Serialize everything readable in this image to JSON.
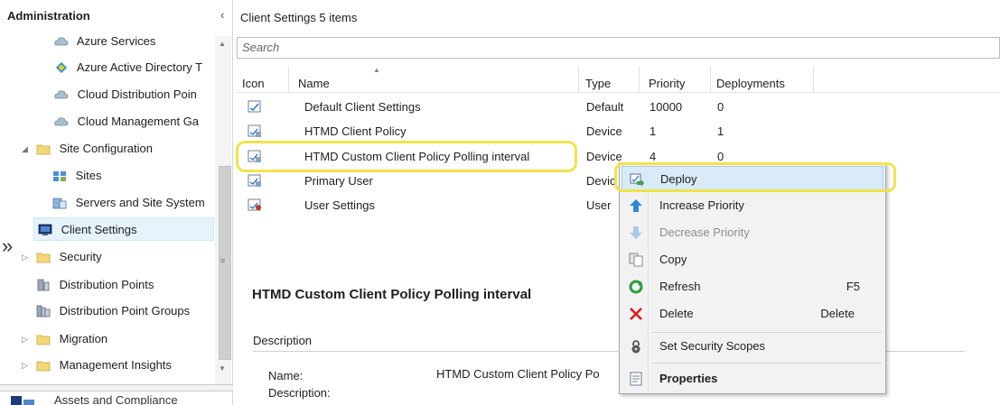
{
  "nav": {
    "header": "Administration",
    "collapse_glyph": "‹",
    "items": [
      {
        "label": "Azure Services",
        "icon": "cloud-icon"
      },
      {
        "label": "Azure Active Directory T",
        "icon": "azure-ad-icon"
      },
      {
        "label": "Cloud Distribution Poin",
        "icon": "cloud-icon"
      },
      {
        "label": "Cloud Management Ga",
        "icon": "cloud-icon"
      },
      {
        "label": "Site Configuration",
        "icon": "folder-icon"
      },
      {
        "label": "Sites",
        "icon": "sites-icon"
      },
      {
        "label": "Servers and Site System",
        "icon": "servers-icon"
      },
      {
        "label": "Client Settings",
        "icon": "client-settings-icon"
      },
      {
        "label": "Security",
        "icon": "folder-icon"
      },
      {
        "label": "Distribution Points",
        "icon": "distribution-points-icon"
      },
      {
        "label": "Distribution Point Groups",
        "icon": "distribution-point-groups-icon"
      },
      {
        "label": "Migration",
        "icon": "folder-icon"
      },
      {
        "label": "Management Insights",
        "icon": "folder-icon"
      }
    ],
    "bottom_label": "Assets and Compliance",
    "double_chevron": "»"
  },
  "main": {
    "title": "Client Settings 5 items",
    "search_placeholder": "Search",
    "columns": [
      "Icon",
      "Name",
      "Type",
      "Priority",
      "Deployments"
    ],
    "rows": [
      {
        "name": "Default Client Settings",
        "type": "Default",
        "priority": "10000",
        "deployments": "0"
      },
      {
        "name": "HTMD Client Policy",
        "type": "Device",
        "priority": "1",
        "deployments": "1"
      },
      {
        "name": "HTMD Custom Client Policy Polling interval",
        "type": "Device",
        "priority": "4",
        "deployments": "0"
      },
      {
        "name": "Primary User",
        "type": "Devic",
        "priority": "",
        "deployments": ""
      },
      {
        "name": "User Settings",
        "type": "User",
        "priority": "",
        "deployments": ""
      }
    ]
  },
  "details": {
    "title": "HTMD Custom Client Policy Polling interval",
    "section": "Description",
    "name_label": "Name:",
    "name_value": "HTMD Custom Client Policy Po",
    "description_label": "Description:"
  },
  "context_menu": {
    "items": [
      {
        "label": "Deploy",
        "shortcut": "",
        "icon": "deploy-icon",
        "enabled": true
      },
      {
        "label": "Increase Priority",
        "shortcut": "",
        "icon": "arrow-up-icon",
        "enabled": true
      },
      {
        "label": "Decrease Priority",
        "shortcut": "",
        "icon": "arrow-down-icon",
        "enabled": false
      },
      {
        "label": "Copy",
        "shortcut": "",
        "icon": "copy-icon",
        "enabled": true
      },
      {
        "label": "Refresh",
        "shortcut": "F5",
        "icon": "refresh-icon",
        "enabled": true
      },
      {
        "label": "Delete",
        "shortcut": "Delete",
        "icon": "delete-icon",
        "enabled": true
      },
      {
        "label": "Set Security Scopes",
        "shortcut": "",
        "icon": "lock-icon",
        "enabled": true
      },
      {
        "label": "Properties",
        "shortcut": "",
        "icon": "properties-icon",
        "enabled": true
      }
    ]
  },
  "colors": {
    "selection": "#e5f3fb",
    "highlight": "#f1e34b",
    "menu_bg": "#f2f2f2",
    "menu_hover": "#d9ebf8"
  }
}
